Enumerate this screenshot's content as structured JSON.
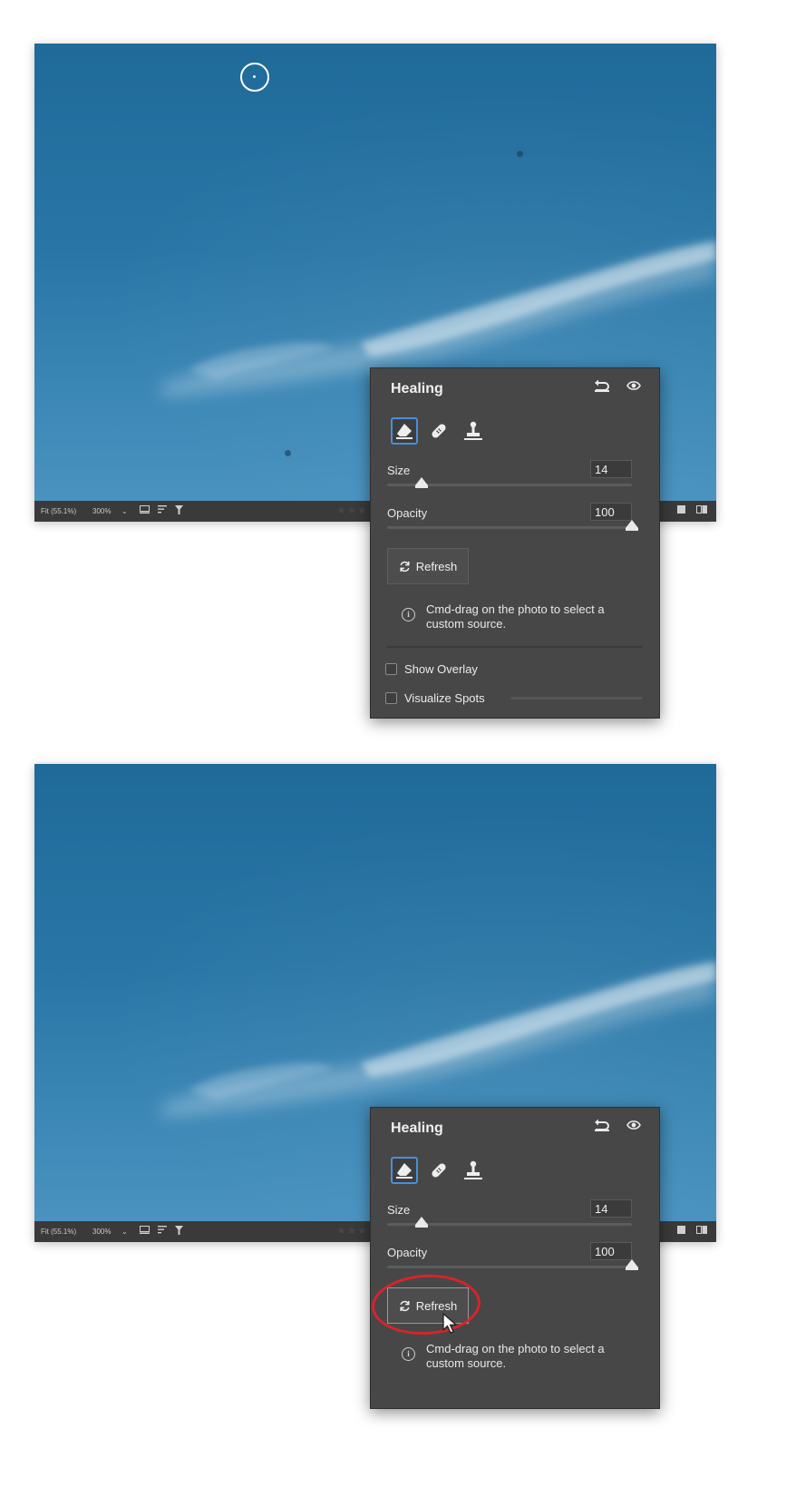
{
  "colors": {
    "sky": "#2976a6",
    "panel_bg": "#474747",
    "statusbar_bg": "#3a3a3a",
    "selection_blue": "#4a8fd9",
    "highlight_red": "#d8242a"
  },
  "statusbar": {
    "zoom_fit": "Fit (55.1%)",
    "zoom_percent": "300%",
    "zoom_caret": "⌄",
    "rating": "☆ ☆ ☆",
    "icons": [
      "grid-view-icon",
      "sort-icon",
      "filter-icon",
      "single-view-icon",
      "compare-view-icon"
    ]
  },
  "top": {
    "panel": {
      "title": "Healing",
      "tools": [
        "content-aware-remove-icon",
        "heal-bandage-icon",
        "clone-stamp-icon"
      ],
      "selected_tool": "content-aware-remove-icon",
      "size": {
        "label": "Size",
        "value": "14",
        "level_percent": 14
      },
      "opacity": {
        "label": "Opacity",
        "value": "100",
        "level_percent": 100
      },
      "refresh_label": "Refresh",
      "info_text": "Cmd-drag on the photo to select a custom source.",
      "show_overlay": {
        "label": "Show Overlay",
        "checked": false
      },
      "visualize_spots": {
        "label": "Visualize Spots",
        "checked": false
      }
    }
  },
  "bottom": {
    "panel": {
      "title": "Healing",
      "tools": [
        "content-aware-remove-icon",
        "heal-bandage-icon",
        "clone-stamp-icon"
      ],
      "selected_tool": "content-aware-remove-icon",
      "size": {
        "label": "Size",
        "value": "14",
        "level_percent": 14
      },
      "opacity": {
        "label": "Opacity",
        "value": "100",
        "level_percent": 100
      },
      "refresh_label": "Refresh",
      "info_text": "Cmd-drag on the photo to select a custom source."
    }
  }
}
